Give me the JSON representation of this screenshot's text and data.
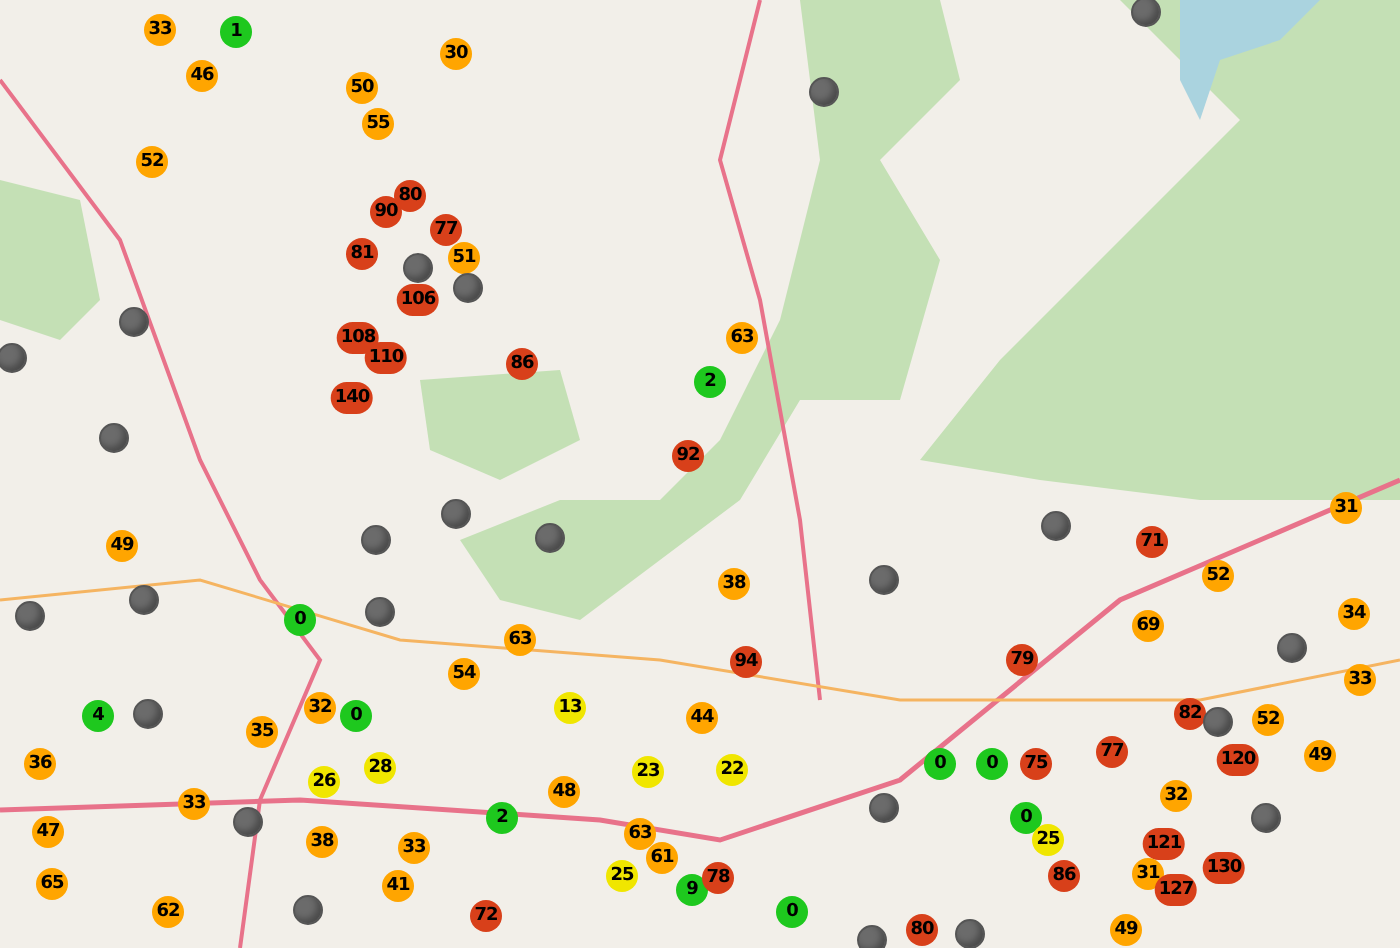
{
  "map": {
    "markers": [
      {
        "kind": "reading",
        "label": "33",
        "color": "#ffa500"
      },
      {
        "kind": "reading",
        "label": "1",
        "color": "#1ec81e"
      },
      {
        "kind": "offline",
        "color": "#6b6b6b"
      },
      {
        "kind": "reading",
        "label": "46",
        "color": "#ffa500"
      },
      {
        "kind": "reading",
        "label": "50",
        "color": "#ffa500"
      },
      {
        "kind": "reading",
        "label": "30",
        "color": "#ffa500"
      },
      {
        "kind": "offline",
        "color": "#6b6b6b"
      },
      {
        "kind": "reading",
        "label": "55",
        "color": "#ffa500"
      },
      {
        "kind": "reading",
        "label": "52",
        "color": "#ffa500"
      },
      {
        "kind": "reading",
        "label": "90",
        "color": "#d8401a"
      },
      {
        "kind": "reading",
        "label": "80",
        "color": "#d8401a"
      },
      {
        "kind": "reading",
        "label": "77",
        "color": "#d8401a"
      },
      {
        "kind": "reading",
        "label": "81",
        "color": "#d8401a"
      },
      {
        "kind": "offline",
        "color": "#6b6b6b"
      },
      {
        "kind": "reading",
        "label": "51",
        "color": "#ffa500"
      },
      {
        "kind": "offline",
        "color": "#6b6b6b"
      },
      {
        "kind": "reading",
        "label": "106",
        "color": "#d8401a"
      },
      {
        "kind": "offline",
        "color": "#6b6b6b"
      },
      {
        "kind": "offline",
        "color": "#6b6b6b"
      },
      {
        "kind": "reading",
        "label": "108",
        "color": "#d8401a"
      },
      {
        "kind": "reading",
        "label": "110",
        "color": "#d8401a"
      },
      {
        "kind": "reading",
        "label": "86",
        "color": "#d8401a"
      },
      {
        "kind": "reading",
        "label": "2",
        "color": "#1ec81e"
      },
      {
        "kind": "reading",
        "label": "63",
        "color": "#ffa500"
      },
      {
        "kind": "reading",
        "label": "140",
        "color": "#d8401a"
      },
      {
        "kind": "offline",
        "color": "#6b6b6b"
      },
      {
        "kind": "reading",
        "label": "92",
        "color": "#d8401a"
      },
      {
        "kind": "offline",
        "color": "#6b6b6b"
      },
      {
        "kind": "offline",
        "color": "#6b6b6b"
      },
      {
        "kind": "reading",
        "label": "31",
        "color": "#ffa500"
      },
      {
        "kind": "reading",
        "label": "49",
        "color": "#ffa500"
      },
      {
        "kind": "offline",
        "color": "#6b6b6b"
      },
      {
        "kind": "offline",
        "color": "#6b6b6b"
      },
      {
        "kind": "reading",
        "label": "71",
        "color": "#d8401a"
      },
      {
        "kind": "offline",
        "color": "#6b6b6b"
      },
      {
        "kind": "offline",
        "color": "#6b6b6b"
      },
      {
        "kind": "reading",
        "label": "0",
        "color": "#1ec81e"
      },
      {
        "kind": "offline",
        "color": "#6b6b6b"
      },
      {
        "kind": "reading",
        "label": "38",
        "color": "#ffa500"
      },
      {
        "kind": "offline",
        "color": "#6b6b6b"
      },
      {
        "kind": "reading",
        "label": "52",
        "color": "#ffa500"
      },
      {
        "kind": "reading",
        "label": "34",
        "color": "#ffa500"
      },
      {
        "kind": "reading",
        "label": "63",
        "color": "#ffa500"
      },
      {
        "kind": "reading",
        "label": "94",
        "color": "#d8401a"
      },
      {
        "kind": "reading",
        "label": "79",
        "color": "#d8401a"
      },
      {
        "kind": "reading",
        "label": "69",
        "color": "#ffa500"
      },
      {
        "kind": "offline",
        "color": "#6b6b6b"
      },
      {
        "kind": "reading",
        "label": "4",
        "color": "#1ec81e"
      },
      {
        "kind": "offline",
        "color": "#6b6b6b"
      },
      {
        "kind": "reading",
        "label": "32",
        "color": "#ffa500"
      },
      {
        "kind": "reading",
        "label": "0",
        "color": "#1ec81e"
      },
      {
        "kind": "reading",
        "label": "54",
        "color": "#ffa500"
      },
      {
        "kind": "reading",
        "label": "13",
        "color": "#f0e600"
      },
      {
        "kind": "reading",
        "label": "44",
        "color": "#ffa500"
      },
      {
        "kind": "reading",
        "label": "82",
        "color": "#d8401a"
      },
      {
        "kind": "reading",
        "label": "33",
        "color": "#ffa500"
      },
      {
        "kind": "reading",
        "label": "36",
        "color": "#ffa500"
      },
      {
        "kind": "reading",
        "label": "35",
        "color": "#ffa500"
      },
      {
        "kind": "reading",
        "label": "0",
        "color": "#1ec81e"
      },
      {
        "kind": "reading",
        "label": "0",
        "color": "#1ec81e"
      },
      {
        "kind": "reading",
        "label": "75",
        "color": "#d8401a"
      },
      {
        "kind": "reading",
        "label": "77",
        "color": "#d8401a"
      },
      {
        "kind": "offline",
        "color": "#6b6b6b"
      },
      {
        "kind": "reading",
        "label": "120",
        "color": "#d8401a"
      },
      {
        "kind": "reading",
        "label": "52",
        "color": "#ffa500"
      },
      {
        "kind": "reading",
        "label": "49",
        "color": "#ffa500"
      },
      {
        "kind": "reading",
        "label": "33",
        "color": "#ffa500"
      },
      {
        "kind": "reading",
        "label": "26",
        "color": "#f0e600"
      },
      {
        "kind": "reading",
        "label": "28",
        "color": "#f0e600"
      },
      {
        "kind": "reading",
        "label": "48",
        "color": "#ffa500"
      },
      {
        "kind": "reading",
        "label": "23",
        "color": "#f0e600"
      },
      {
        "kind": "reading",
        "label": "22",
        "color": "#f0e600"
      },
      {
        "kind": "offline",
        "color": "#6b6b6b"
      },
      {
        "kind": "reading",
        "label": "32",
        "color": "#ffa500"
      },
      {
        "kind": "reading",
        "label": "47",
        "color": "#ffa500"
      },
      {
        "kind": "offline",
        "color": "#6b6b6b"
      },
      {
        "kind": "reading",
        "label": "38",
        "color": "#ffa500"
      },
      {
        "kind": "reading",
        "label": "33",
        "color": "#ffa500"
      },
      {
        "kind": "reading",
        "label": "2",
        "color": "#1ec81e"
      },
      {
        "kind": "reading",
        "label": "63",
        "color": "#ffa500"
      },
      {
        "kind": "reading",
        "label": "61",
        "color": "#ffa500"
      },
      {
        "kind": "reading",
        "label": "0",
        "color": "#1ec81e"
      },
      {
        "kind": "reading",
        "label": "25",
        "color": "#f0e600"
      },
      {
        "kind": "reading",
        "label": "121",
        "color": "#d8401a"
      },
      {
        "kind": "offline",
        "color": "#6b6b6b"
      },
      {
        "kind": "reading",
        "label": "65",
        "color": "#ffa500"
      },
      {
        "kind": "offline",
        "color": "#6b6b6b"
      },
      {
        "kind": "reading",
        "label": "41",
        "color": "#ffa500"
      },
      {
        "kind": "reading",
        "label": "25",
        "color": "#f0e600"
      },
      {
        "kind": "reading",
        "label": "9",
        "color": "#1ec81e"
      },
      {
        "kind": "reading",
        "label": "78",
        "color": "#d8401a"
      },
      {
        "kind": "reading",
        "label": "86",
        "color": "#d8401a"
      },
      {
        "kind": "reading",
        "label": "31",
        "color": "#ffa500"
      },
      {
        "kind": "reading",
        "label": "127",
        "color": "#d8401a"
      },
      {
        "kind": "reading",
        "label": "130",
        "color": "#d8401a"
      },
      {
        "kind": "reading",
        "label": "62",
        "color": "#ffa500"
      },
      {
        "kind": "reading",
        "label": "72",
        "color": "#d8401a"
      },
      {
        "kind": "reading",
        "label": "0",
        "color": "#1ec81e"
      },
      {
        "kind": "offline",
        "color": "#6b6b6b"
      },
      {
        "kind": "reading",
        "label": "80",
        "color": "#d8401a"
      },
      {
        "kind": "offline",
        "color": "#6b6b6b"
      },
      {
        "kind": "reading",
        "label": "49",
        "color": "#ffa500"
      }
    ]
  }
}
